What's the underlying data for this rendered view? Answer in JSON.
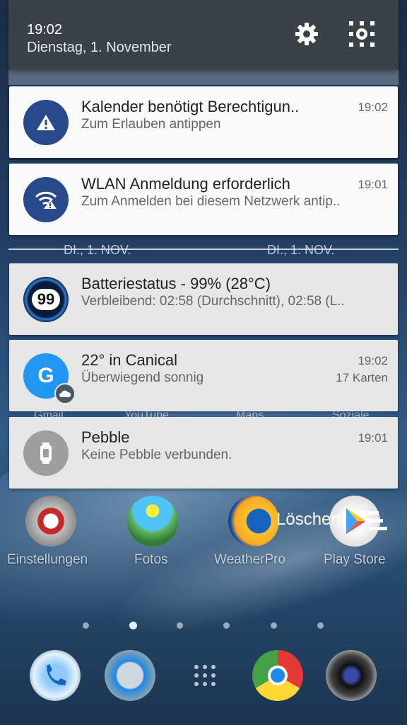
{
  "status": {
    "time": "19:02",
    "date": "Dienstag, 1. November",
    "settings_icon": "gear-icon",
    "quick_settings_icon": "qs-grid-icon"
  },
  "background": {
    "date_left": "DI., 1. NOV.",
    "date_right": "DI., 1. NOV.",
    "labels_row": [
      "Gmail",
      "YouTube",
      "Maps",
      "Soziale"
    ]
  },
  "notifications": [
    {
      "title": "Kalender benötigt Berechtigun..",
      "subtitle": "Zum Erlauben antippen",
      "time": "19:02",
      "icon": "warning-icon",
      "color": "#284a8c"
    },
    {
      "title": "WLAN Anmeldung erforderlich",
      "subtitle": "Zum Anmelden bei diesem Netzwerk antip..",
      "time": "19:01",
      "icon": "wifi-warning-icon",
      "color": "#284a8c"
    },
    {
      "title": "Batteriestatus - 99% (28°C)",
      "subtitle": "Verbleibend: 02:58 (Durchschnitt), 02:58 (L..",
      "badge": "99",
      "icon": "battery-badge-icon"
    },
    {
      "title": "22° in Canical",
      "subtitle": "Überwiegend sonnig",
      "time": "19:02",
      "meta": "17 Karten",
      "letter": "G",
      "icon": "google-icon",
      "color": "#2196f3"
    },
    {
      "title": "Pebble",
      "subtitle": "Keine Pebble verbunden.",
      "time": "19:01",
      "icon": "watch-icon",
      "color": "#9e9e9e"
    }
  ],
  "clear_all": {
    "label": "Löschen",
    "icon": "clear-all-icon"
  },
  "apps": [
    {
      "label": "Einstellungen",
      "icon": "settings-app-icon"
    },
    {
      "label": "Fotos",
      "icon": "photos-app-icon"
    },
    {
      "label": "WeatherPro",
      "icon": "weather-app-icon"
    },
    {
      "label": "Play Store",
      "icon": "play-store-icon"
    }
  ],
  "dock": [
    {
      "icon": "phone-icon"
    },
    {
      "icon": "messages-icon"
    },
    {
      "icon": "app-drawer-icon"
    },
    {
      "icon": "chrome-icon"
    },
    {
      "icon": "camera-icon"
    }
  ]
}
